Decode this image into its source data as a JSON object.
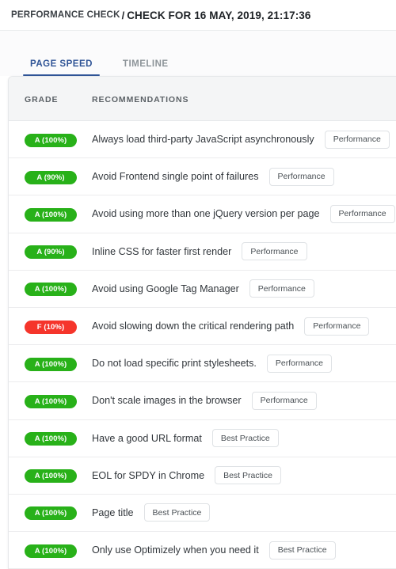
{
  "breadcrumb": {
    "parent": "PERFORMANCE CHECK",
    "separator": "/",
    "current": "CHECK FOR 16 MAY, 2019, 21:17:36"
  },
  "tabs": [
    {
      "label": "PAGE SPEED",
      "active": true
    },
    {
      "label": "TIMELINE",
      "active": false
    }
  ],
  "table": {
    "columns": {
      "grade": "GRADE",
      "recommendations": "RECOMMENDATIONS"
    },
    "rows": [
      {
        "grade": "A (100%)",
        "grade_letter": "A",
        "score": 100,
        "recommendation": "Always load third-party JavaScript asynchronously",
        "tag": "Performance"
      },
      {
        "grade": "A (90%)",
        "grade_letter": "A",
        "score": 90,
        "recommendation": "Avoid Frontend single point of failures",
        "tag": "Performance"
      },
      {
        "grade": "A (100%)",
        "grade_letter": "A",
        "score": 100,
        "recommendation": "Avoid using more than one jQuery version per page",
        "tag": "Performance"
      },
      {
        "grade": "A (90%)",
        "grade_letter": "A",
        "score": 90,
        "recommendation": "Inline CSS for faster first render",
        "tag": "Performance"
      },
      {
        "grade": "A (100%)",
        "grade_letter": "A",
        "score": 100,
        "recommendation": "Avoid using Google Tag Manager",
        "tag": "Performance"
      },
      {
        "grade": "F (10%)",
        "grade_letter": "F",
        "score": 10,
        "recommendation": "Avoid slowing down the critical rendering path",
        "tag": "Performance"
      },
      {
        "grade": "A (100%)",
        "grade_letter": "A",
        "score": 100,
        "recommendation": "Do not load specific print stylesheets.",
        "tag": "Performance"
      },
      {
        "grade": "A (100%)",
        "grade_letter": "A",
        "score": 100,
        "recommendation": "Don't scale images in the browser",
        "tag": "Performance"
      },
      {
        "grade": "A (100%)",
        "grade_letter": "A",
        "score": 100,
        "recommendation": "Have a good URL format",
        "tag": "Best Practice"
      },
      {
        "grade": "A (100%)",
        "grade_letter": "A",
        "score": 100,
        "recommendation": "EOL for SPDY in Chrome",
        "tag": "Best Practice"
      },
      {
        "grade": "A (100%)",
        "grade_letter": "A",
        "score": 100,
        "recommendation": "Page title",
        "tag": "Best Practice"
      },
      {
        "grade": "A (100%)",
        "grade_letter": "A",
        "score": 100,
        "recommendation": "Only use Optimizely when you need it",
        "tag": "Best Practice"
      }
    ]
  },
  "colors": {
    "grade_a": "#28b119",
    "grade_f": "#f5352b",
    "tab_active": "#2f5496",
    "header_bg": "#f4f5f6"
  }
}
